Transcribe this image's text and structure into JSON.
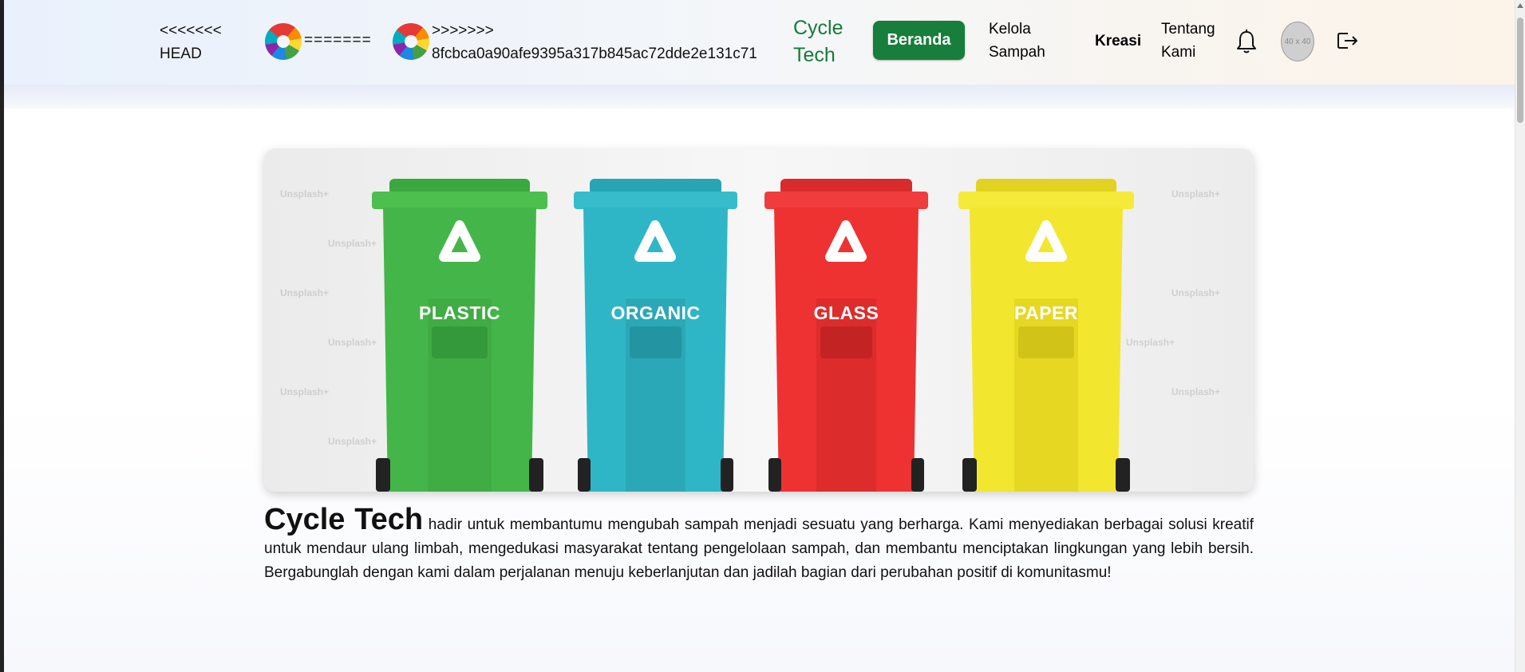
{
  "header": {
    "conflict_head": "<<<<<<< HEAD",
    "conflict_separator": "=======",
    "conflict_commit": ">>>>>>> 8fcbca0a90afe9395a317b845ac72dde2e131c71",
    "brand": "Cycle Tech",
    "nav": {
      "beranda": "Beranda",
      "kelola": "Kelola Sampah",
      "kreasi": "Kreasi",
      "tentang": "Tentang Kami"
    },
    "avatar_placeholder": "40 x 40",
    "icons": [
      "logo-icon",
      "bell-icon",
      "logout-icon"
    ]
  },
  "hero": {
    "bins": [
      {
        "label": "PLASTIC",
        "color": "#43b649"
      },
      {
        "label": "ORGANIC",
        "color": "#2fb6c6"
      },
      {
        "label": "GLASS",
        "color": "#ee3232"
      },
      {
        "label": "PAPER",
        "color": "#f3e62e"
      }
    ],
    "watermark": "Unsplash+"
  },
  "intro": {
    "title": "Cycle Tech",
    "text": "hadir untuk membantumu mengubah sampah menjadi sesuatu yang berharga. Kami menyediakan berbagai solusi kreatif untuk mendaur ulang limbah, mengedukasi masyarakat tentang pengelolaan sampah, dan membantu menciptakan lingkungan yang lebih bersih. Bergabunglah dengan kami dalam perjalanan menuju keberlanjutan dan jadilah bagian dari perubahan positif di komunitasmu!"
  },
  "colors": {
    "brand_green": "#177a3b",
    "button_green": "#177e3b"
  }
}
